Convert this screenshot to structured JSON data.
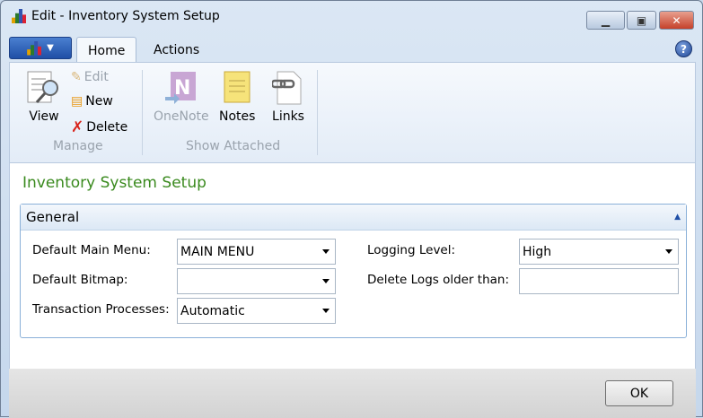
{
  "window": {
    "title": "Edit - Inventory System Setup",
    "minimize": "▁",
    "maximize": "▣",
    "close": "✕"
  },
  "ribbon": {
    "tabs": [
      {
        "label": "Home",
        "active": true
      },
      {
        "label": "Actions",
        "active": false
      }
    ],
    "help": "?",
    "groups": [
      {
        "label": "Manage",
        "items": [
          {
            "label": "View",
            "enabled": true
          },
          {
            "label": "Edit",
            "enabled": false
          },
          {
            "label": "New",
            "enabled": true
          },
          {
            "label": "Delete",
            "enabled": true
          }
        ]
      },
      {
        "label": "Show Attached",
        "items": [
          {
            "label": "OneNote",
            "enabled": false
          },
          {
            "label": "Notes",
            "enabled": true
          },
          {
            "label": "Links",
            "enabled": true
          }
        ]
      }
    ]
  },
  "page": {
    "title": "Inventory System Setup"
  },
  "general": {
    "header": "General",
    "fields": {
      "default_main_menu": {
        "label": "Default Main Menu:",
        "value": "MAIN MENU"
      },
      "default_bitmap": {
        "label": "Default Bitmap:",
        "value": ""
      },
      "transaction_processes": {
        "label": "Transaction Processes:",
        "value": "Automatic"
      },
      "logging_level": {
        "label": "Logging Level:",
        "value": "High"
      },
      "delete_logs_older_than": {
        "label": "Delete Logs older than:",
        "value": ""
      }
    }
  },
  "footer": {
    "ok": "OK"
  }
}
